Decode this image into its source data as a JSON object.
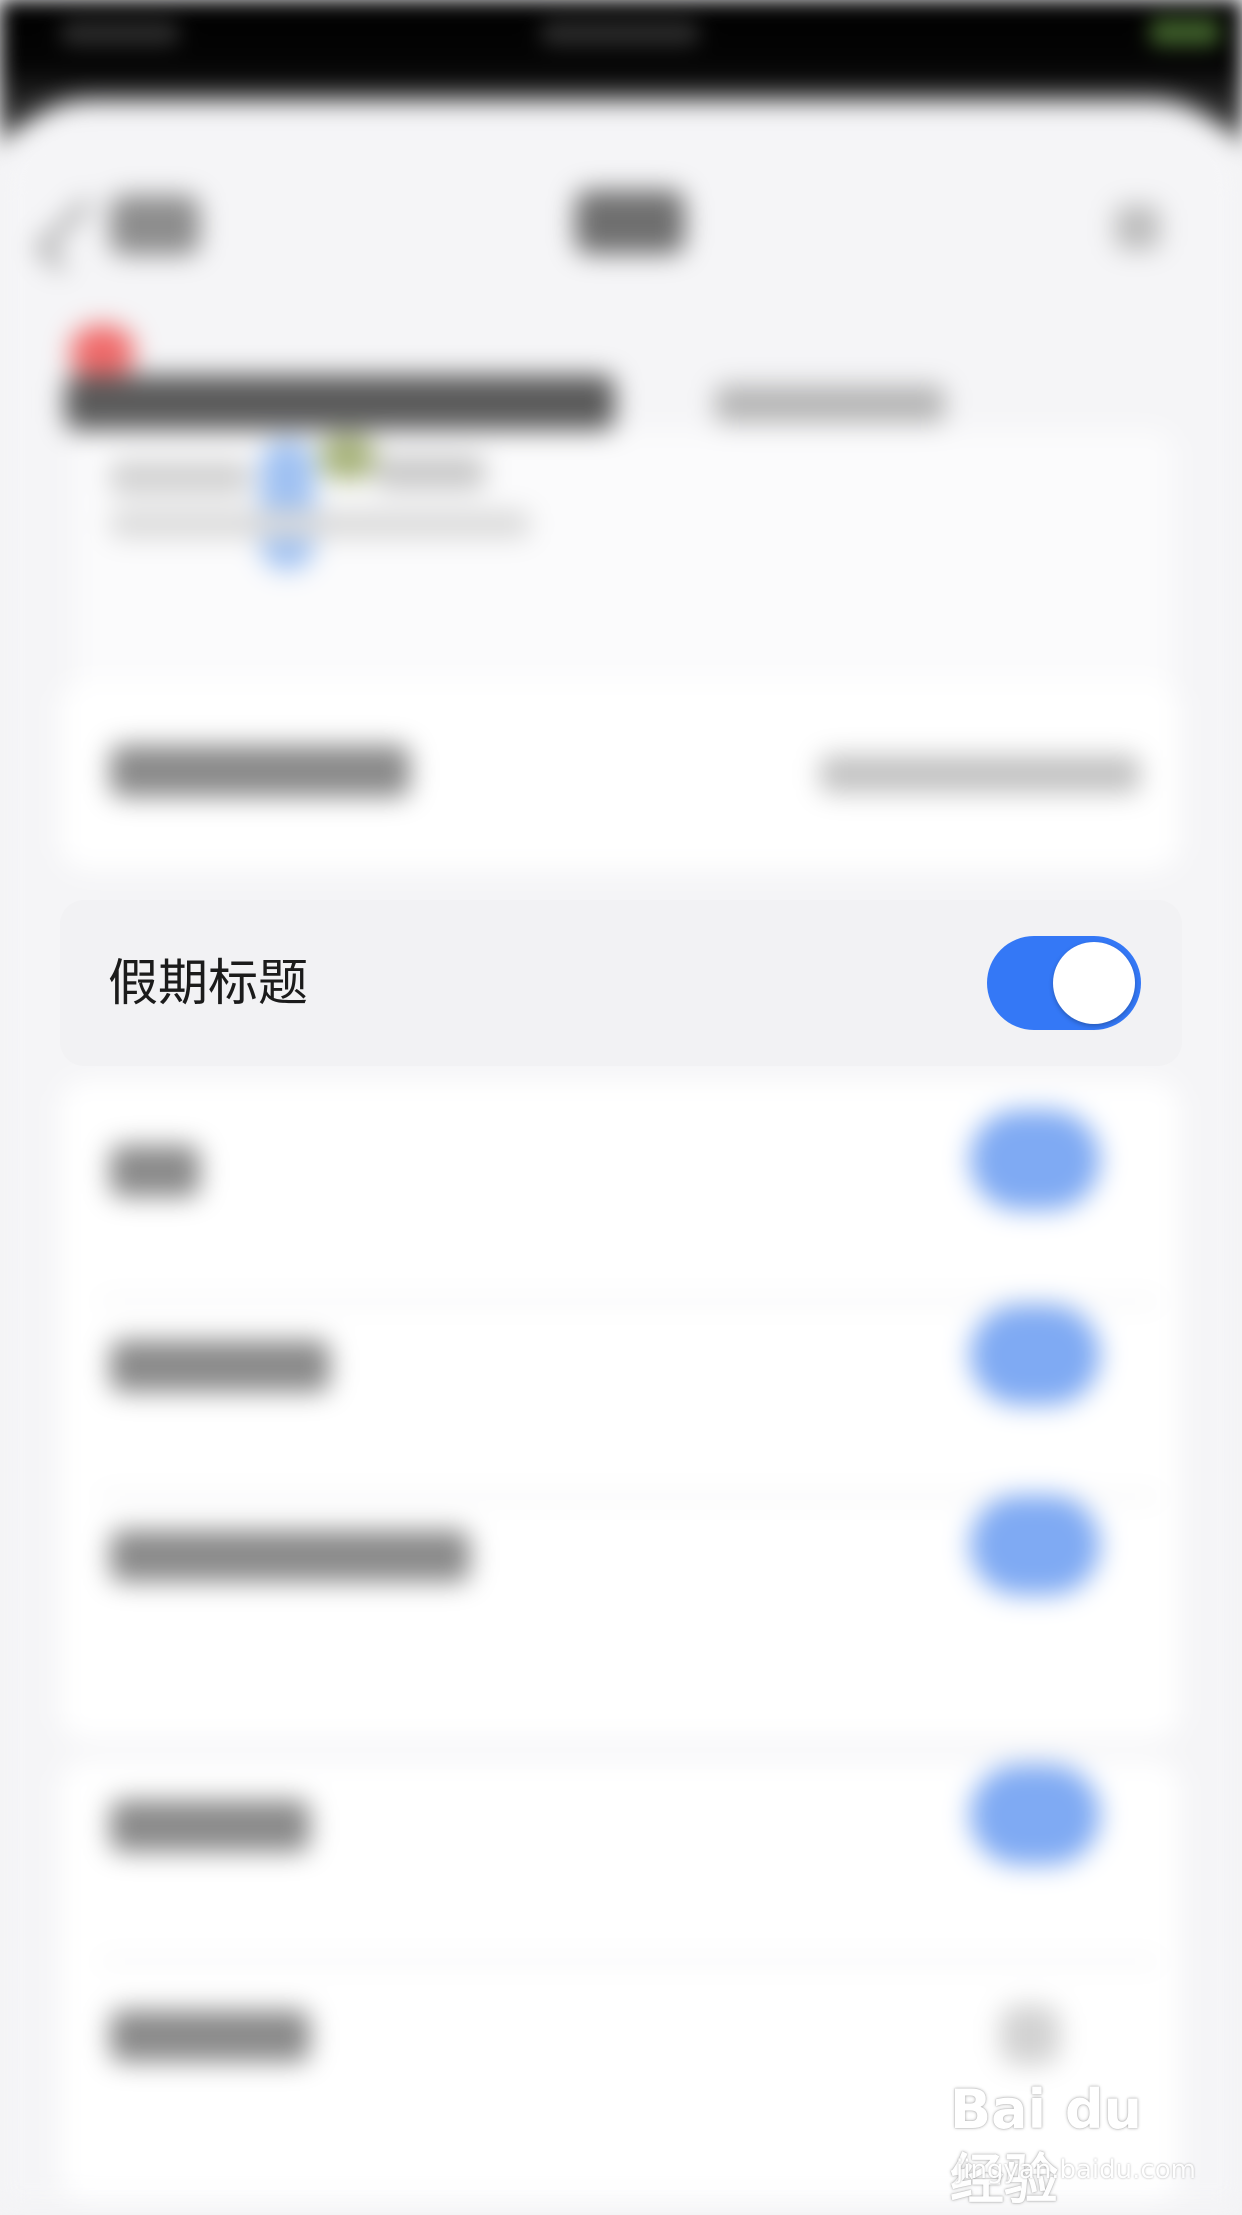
{
  "holiday_title_setting": {
    "label": "假期标题",
    "enabled": true,
    "toggle_color": "#3478f6"
  },
  "watermark": {
    "logo": "Bai du 经验",
    "url": "jingyan.baidu.com"
  }
}
